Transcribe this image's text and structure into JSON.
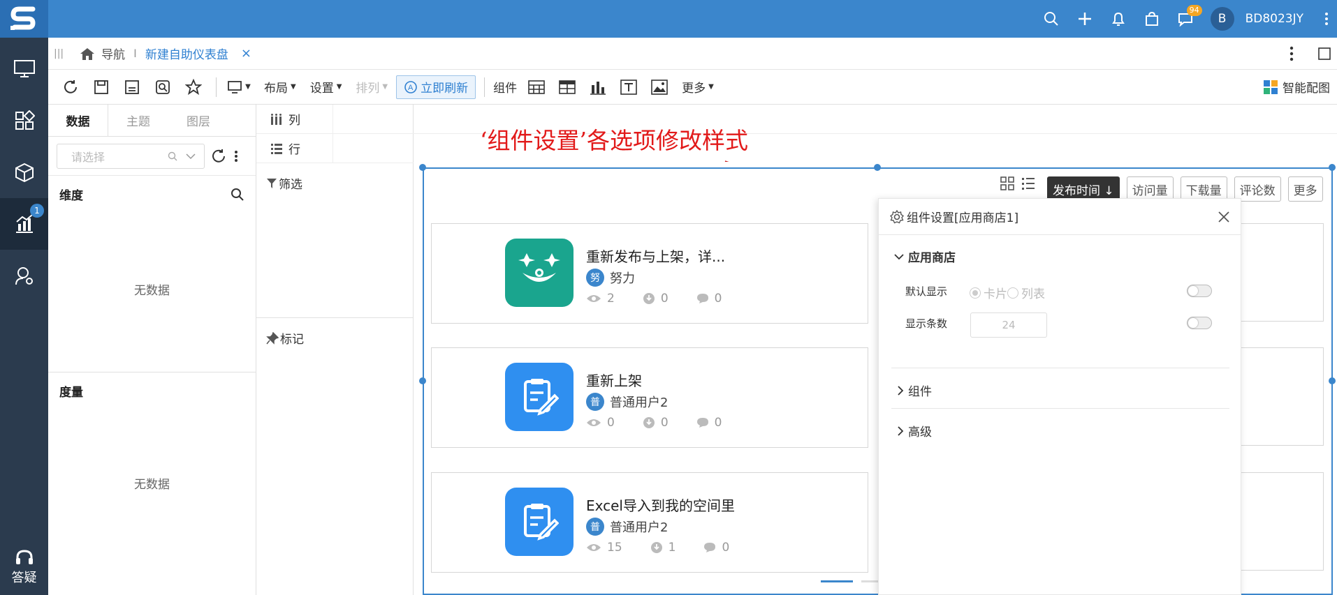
{
  "app": {
    "user_initial": "B",
    "user_name": "BD8023JY",
    "msg_badge": "94"
  },
  "sidebar": {
    "items": [
      {
        "icon": "monitor-icon"
      },
      {
        "icon": "apps-icon"
      },
      {
        "icon": "cube-icon"
      },
      {
        "icon": "analytics-icon",
        "badge": "1",
        "active": true
      },
      {
        "icon": "user-settings-icon"
      }
    ],
    "help_label": "答疑"
  },
  "tabs": {
    "home_label": "导航",
    "active_tab": "新建自助仪表盘",
    "close": "×"
  },
  "toolbar": {
    "layout": "布局",
    "settings": "设置",
    "arrange": "排列",
    "refresh": "立即刷新",
    "components": "组件",
    "more": "更多",
    "smart": "智能配图"
  },
  "left": {
    "tabs": [
      "数据",
      "主题",
      "图层"
    ],
    "select_placeholder": "请选择",
    "dimension": "维度",
    "measure": "度量",
    "no_data": "无数据"
  },
  "shelves": {
    "columns": "列",
    "rows": "行",
    "filter": "筛选",
    "mark": "标记"
  },
  "annotation": "‘组件设置’各选项修改样式",
  "widget": {
    "sort_buttons": [
      "发布时间 ↓",
      "访问量",
      "下载量",
      "评论数",
      "更多"
    ]
  },
  "cards": [
    {
      "title": "重新发布与上架，详...",
      "author_badge": "努",
      "author": "努力",
      "views": "2",
      "downloads": "0",
      "comments": "0",
      "color": "#1aa58e"
    },
    {
      "title": "重新上架",
      "author_badge": "普",
      "author": "普通用户2",
      "views": "0",
      "downloads": "0",
      "comments": "0",
      "color": "#2f8ff0"
    },
    {
      "title": "Excel导入到我的空间里",
      "author_badge": "普",
      "author": "普通用户2",
      "views": "15",
      "downloads": "1",
      "comments": "0",
      "color": "#2f8ff0"
    }
  ],
  "panel": {
    "title": "组件设置[应用商店1]",
    "section": "应用商店",
    "default_display": "默认显示",
    "opt_card": "卡片",
    "opt_list": "列表",
    "count_label": "显示条数",
    "count_value": "24",
    "group_component": "组件",
    "group_advanced": "高级"
  }
}
